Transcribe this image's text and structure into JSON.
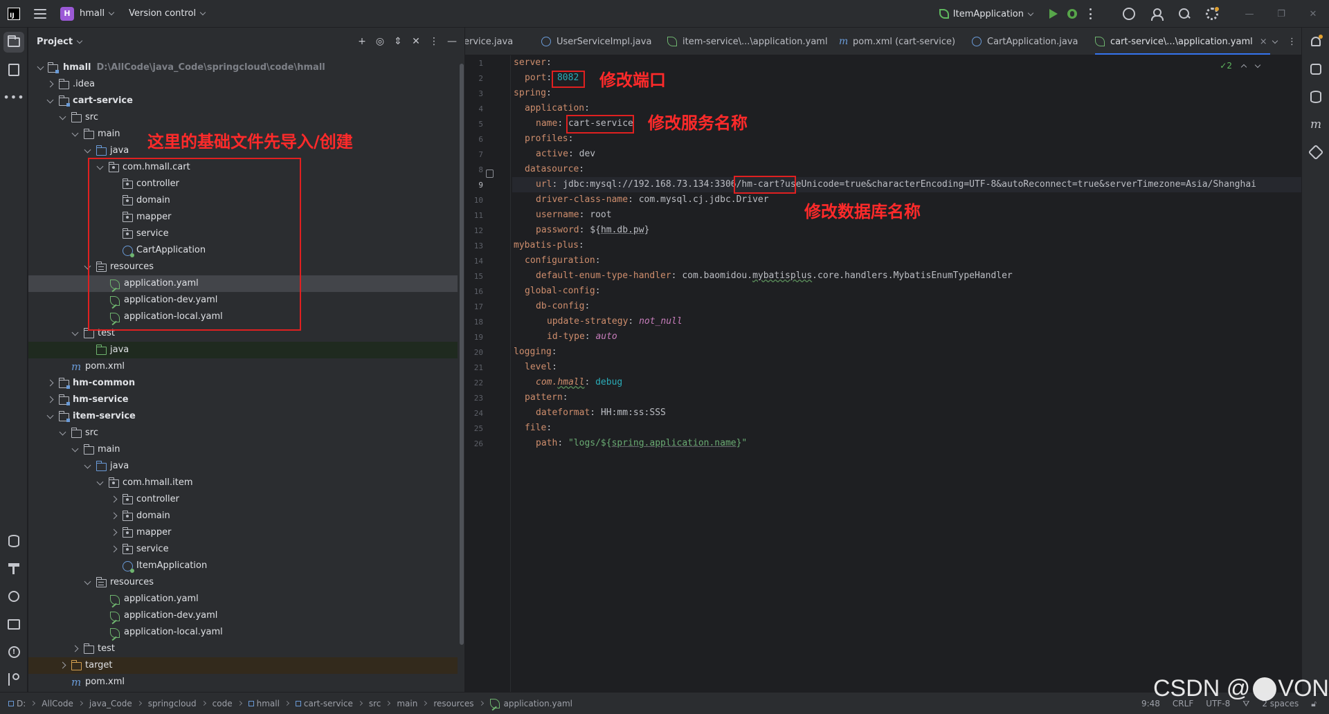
{
  "titlebar": {
    "app_logo": "IJ",
    "project_badge": "H",
    "project_name": "hmall",
    "version_control": "Version control",
    "run_config": "ItemApplication",
    "icons": [
      "hamburger-icon",
      "play-icon",
      "debug-icon",
      "ai-icon",
      "user-icon",
      "search-icon",
      "settings-icon"
    ],
    "window_min": "—",
    "window_max": "❐",
    "window_close": "✕"
  },
  "project_panel": {
    "title": "Project",
    "tree": [
      {
        "label": "hmall",
        "bold": true,
        "hint": "D:\\AllCode\\java_Code\\springcloud\\code\\hmall"
      },
      {
        "label": ".idea"
      },
      {
        "label": "cart-service",
        "bold": true
      },
      {
        "label": "src"
      },
      {
        "label": "main"
      },
      {
        "label": "java"
      },
      {
        "label": "com.hmall.cart"
      },
      {
        "label": "controller"
      },
      {
        "label": "domain"
      },
      {
        "label": "mapper"
      },
      {
        "label": "service"
      },
      {
        "label": "CartApplication"
      },
      {
        "label": "resources"
      },
      {
        "label": "application.yaml"
      },
      {
        "label": "application-dev.yaml"
      },
      {
        "label": "application-local.yaml"
      },
      {
        "label": "test"
      },
      {
        "label": "java"
      },
      {
        "label": "pom.xml"
      },
      {
        "label": "hm-common",
        "bold": true
      },
      {
        "label": "hm-service",
        "bold": true
      },
      {
        "label": "item-service",
        "bold": true
      },
      {
        "label": "src"
      },
      {
        "label": "main"
      },
      {
        "label": "java"
      },
      {
        "label": "com.hmall.item"
      },
      {
        "label": "controller"
      },
      {
        "label": "domain"
      },
      {
        "label": "mapper"
      },
      {
        "label": "service"
      },
      {
        "label": "ItemApplication"
      },
      {
        "label": "resources"
      },
      {
        "label": "application.yaml"
      },
      {
        "label": "application-dev.yaml"
      },
      {
        "label": "application-local.yaml"
      },
      {
        "label": "test"
      },
      {
        "label": "target"
      },
      {
        "label": "pom.xml"
      }
    ]
  },
  "annotations": {
    "tree_note": "这里的基础文件先导入/创建",
    "port_note": "修改端口",
    "name_note": "修改服务名称",
    "db_note": "修改数据库名称"
  },
  "tabs": [
    {
      "label": "ervice.java"
    },
    {
      "label": "UserServiceImpl.java"
    },
    {
      "label": "item-service\\...\\application.yaml"
    },
    {
      "label": "pom.xml (cart-service)"
    },
    {
      "label": "CartApplication.java"
    },
    {
      "label": "cart-service\\...\\application.yaml",
      "close": "×"
    }
  ],
  "editor": {
    "inspections": "✓2",
    "lines": [
      "1",
      "2",
      "3",
      "4",
      "5",
      "6",
      "7",
      "8",
      "9",
      "10",
      "11",
      "12",
      "13",
      "14",
      "15",
      "16",
      "17",
      "18",
      "19",
      "20",
      "21",
      "22",
      "23",
      "24",
      "25",
      "26"
    ],
    "code": {
      "l1_key": "server",
      "l2_key": "port",
      "l2_val": "8082",
      "l3_key": "spring",
      "l4_key": "application",
      "l5_key": "name",
      "l5_val": "cart-service",
      "l6_key": "profiles",
      "l7_key": "active",
      "l7_val": "dev",
      "l8_key": "datasource",
      "l9_key": "url",
      "l9_val_a": "jdbc:mysql://192.168.73.134:3306",
      "l9_val_b": "/hm-cart?",
      "l9_val_c": "useUnicode=true&characterEncoding=UTF-8&autoReconnect=true&serverTimezone=Asia/Shanghai",
      "l10_key": "driver-class-name",
      "l10_val": "com.mysql.cj.jdbc.Driver",
      "l11_key": "username",
      "l11_val": "root",
      "l12_key": "password",
      "l12_val_a": "${",
      "l12_val_b": "hm.db.pw",
      "l12_val_c": "}",
      "l13_key": "mybatis-plus",
      "l14_key": "configuration",
      "l15_key": "default-enum-type-handler",
      "l15_val_a": "com.baomidou.",
      "l15_val_b": "mybatisplus",
      "l15_val_c": ".core.handlers.MybatisEnumTypeHandler",
      "l16_key": "global-config",
      "l17_key": "db-config",
      "l18_key": "update-strategy",
      "l18_val": "not_null",
      "l19_key": "id-type",
      "l19_val": "auto",
      "l20_key": "logging",
      "l21_key": "level",
      "l22_key_a": "com.",
      "l22_key_b": "hmall",
      "l22_val": "debug",
      "l23_key": "pattern",
      "l24_key": "dateformat",
      "l24_val": "HH:mm:ss:SSS",
      "l25_key": "file",
      "l26_key": "path",
      "l26_val_a": "\"logs/${",
      "l26_val_b": "spring.application.name",
      "l26_val_c": "}\""
    }
  },
  "statusbar": {
    "crumbs": [
      "D:",
      "AllCode",
      "java_Code",
      "springcloud",
      "code",
      "hmall",
      "cart-service",
      "src",
      "main",
      "resources",
      "application.yaml"
    ],
    "position": "9:48",
    "line_sep": "CRLF",
    "encoding": "UTF-8",
    "indent": "2 spaces"
  },
  "watermark": {
    "prefix": "CSDN @",
    "suffix": "VON"
  },
  "colors": {
    "accent": "#3574f0",
    "annotation": "#e02020",
    "key": "#cf8e6d",
    "number": "#2aacb8"
  }
}
